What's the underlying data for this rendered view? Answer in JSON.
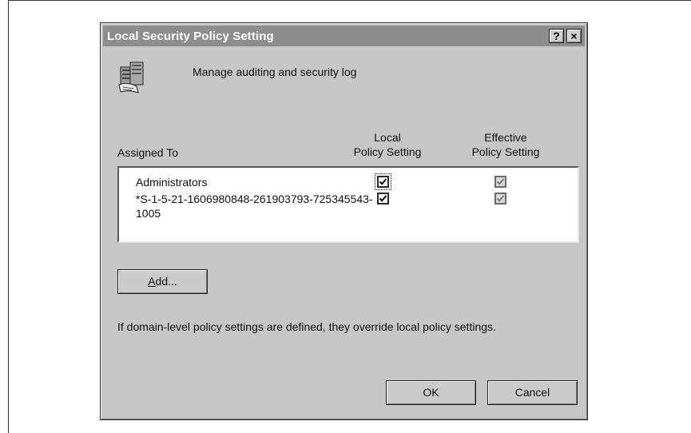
{
  "dialog": {
    "title": "Local Security Policy Setting",
    "help_button": "?",
    "close_button": "×",
    "policy_name": "Manage auditing and security log"
  },
  "columns": {
    "assigned_to": "Assigned To",
    "local_line1": "Local",
    "local_line2": "Policy Setting",
    "effective_line1": "Effective",
    "effective_line2": "Policy Setting"
  },
  "rows": [
    {
      "name": "Administrators",
      "local_checked": true,
      "effective_checked": true
    },
    {
      "name": "*S-1-5-21-1606980848-261903793-725345543-1005",
      "local_checked": true,
      "effective_checked": true
    }
  ],
  "buttons": {
    "add_label_underlined": "A",
    "add_label_rest": "dd...",
    "ok": "OK",
    "cancel": "Cancel"
  },
  "note": "If domain-level policy settings are defined, they override local policy settings."
}
